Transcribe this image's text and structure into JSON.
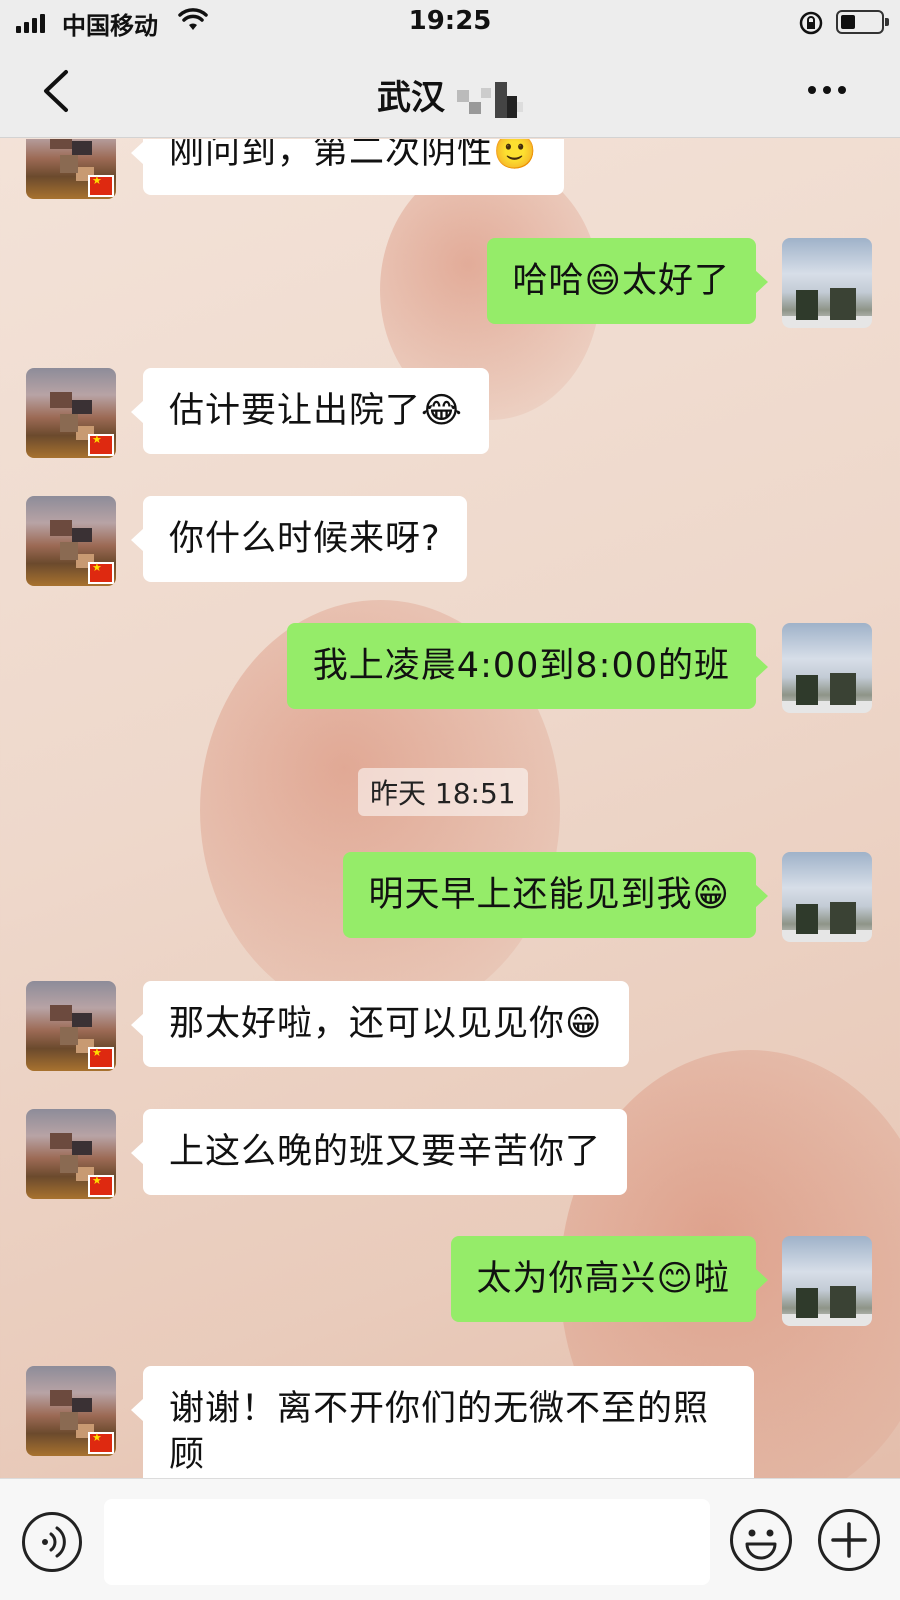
{
  "status_bar": {
    "carrier": "中国移动",
    "time": "19:25"
  },
  "header": {
    "title": "武汉"
  },
  "messages": [
    {
      "side": "left",
      "text": "刚问到，第二次阴性🙂"
    },
    {
      "side": "right",
      "text": "哈哈😄太好了"
    },
    {
      "side": "left",
      "text": "估计要让出院了😂"
    },
    {
      "side": "left",
      "text": "你什么时候来呀?"
    },
    {
      "side": "right",
      "text": "我上凌晨4:00到8:00的班"
    },
    {
      "side": "right",
      "text": "明天早上还能见到我😁"
    },
    {
      "side": "left",
      "text": "那太好啦，还可以见见你😁"
    },
    {
      "side": "left",
      "text": "上这么晚的班又要辛苦你了"
    },
    {
      "side": "right",
      "text": "太为你高兴😊啦"
    },
    {
      "side": "left",
      "text": "谢谢！离不开你们的无微不至的照顾"
    }
  ],
  "timestamp": "昨天 18:51",
  "input": {
    "value": ""
  },
  "colors": {
    "self_bubble": "#95ec69",
    "other_bubble": "#ffffff",
    "bar_background": "#ededed"
  }
}
